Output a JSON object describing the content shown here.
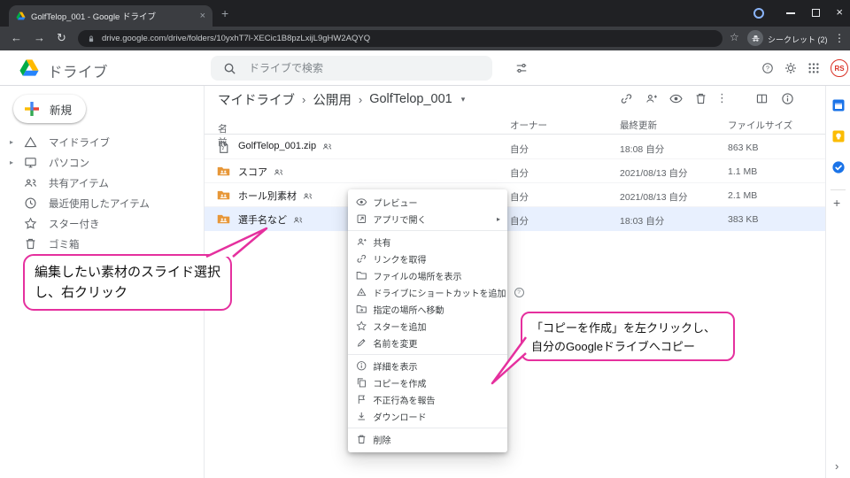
{
  "browser": {
    "tab_title": "GolfTelop_001 - Google ドライブ",
    "url": "drive.google.com/drive/folders/10yxhT7l-XECic1B8pzLxijL9gHW2AQYQ",
    "incognito_label": "シークレット (2)"
  },
  "header": {
    "app_name": "ドライブ",
    "search_placeholder": "ドライブで検索",
    "avatar_initials": "RS"
  },
  "sidebar": {
    "new_label": "新規",
    "items": [
      {
        "label": "マイドライブ"
      },
      {
        "label": "パソコン"
      },
      {
        "label": "共有アイテム"
      },
      {
        "label": "最近使用したアイテム"
      },
      {
        "label": "スター付き"
      },
      {
        "label": "ゴミ箱"
      }
    ]
  },
  "toolbar": {
    "breadcrumb": [
      "マイドライブ",
      "公開用",
      "GolfTelop_001"
    ]
  },
  "filelist": {
    "columns": {
      "name": "名前",
      "owner": "オーナー",
      "modified": "最終更新",
      "size": "ファイルサイズ"
    },
    "rows": [
      {
        "name": "GolfTelop_001.zip",
        "type": "zip",
        "owner": "自分",
        "modified": "18:08 自分",
        "size": "863 KB",
        "selected": false
      },
      {
        "name": "スコア",
        "type": "folder",
        "owner": "自分",
        "modified": "2021/08/13 自分",
        "size": "1.1 MB",
        "selected": false
      },
      {
        "name": "ホール別素材",
        "type": "folder",
        "owner": "自分",
        "modified": "2021/08/13 自分",
        "size": "2.1 MB",
        "selected": false
      },
      {
        "name": "選手名など",
        "type": "folder",
        "owner": "自分",
        "modified": "18:03 自分",
        "size": "383 KB",
        "selected": true
      }
    ]
  },
  "context_menu": {
    "preview": "プレビュー",
    "open_with": "アプリで開く",
    "share": "共有",
    "get_link": "リンクを取得",
    "show_location": "ファイルの場所を表示",
    "add_shortcut": "ドライブにショートカットを追加",
    "move_to": "指定の場所へ移動",
    "add_star": "スターを追加",
    "rename": "名前を変更",
    "details": "詳細を表示",
    "make_copy": "コピーを作成",
    "report": "不正行為を報告",
    "download": "ダウンロード",
    "remove": "削除"
  },
  "annotations": {
    "left_note": "編集したい素材のスライド選択し、右クリック",
    "right_note": "「コピーを作成」を左クリックし、自分のGoogleドライブへコピー"
  },
  "icons": {
    "back": "←",
    "forward": "→",
    "reload": "↻",
    "close": "×",
    "more_v": "⋮",
    "plus": "+",
    "star": "☆",
    "sort_asc": "↑",
    "caret_down": "▾",
    "crumb_sep": "›",
    "expand": "▸",
    "submenu": "▸",
    "collapse_panel": "›",
    "help_mark": "?"
  },
  "colors": {
    "annotation_pink": "#e5309e",
    "selection_blue": "#e8f0fe",
    "folder_icon": "#e79738",
    "drive_blue": "#2684fc",
    "drive_green": "#00ac47",
    "drive_yellow": "#ffba00"
  }
}
